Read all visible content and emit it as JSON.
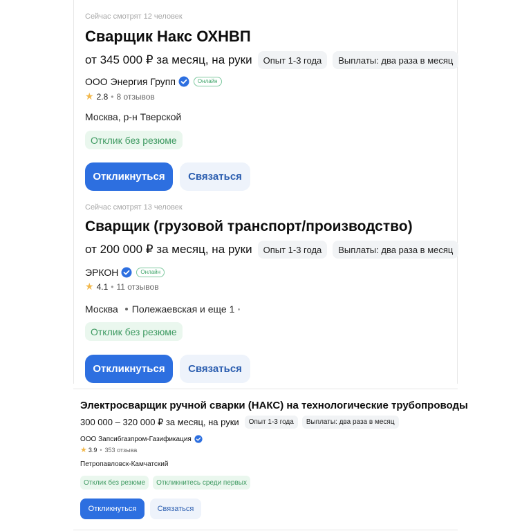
{
  "vacancies": [
    {
      "views": "Сейчас смотрят 12 человек",
      "title": "Сварщик Накс ОХНВП",
      "salary": "от 345 000 ₽ за месяц, на руки",
      "experience": "Опыт 1-3 года",
      "payments": "Выплаты: два раза в месяц",
      "company": "ООО Энергия Групп",
      "online": "Онлайн",
      "rating": "2.8",
      "reviews": "8 отзывов",
      "location": "Москва, р-н Тверской",
      "tag1": "Отклик без резюме",
      "apply": "Откликнуться",
      "contact": "Связаться"
    },
    {
      "views": "Сейчас смотрят 13 человек",
      "title": "Сварщик (грузовой транспорт/производство)",
      "salary": "от 200 000 ₽ за месяц, на руки",
      "experience": "Опыт 1-3 года",
      "payments": "Выплаты: два раза в месяц",
      "company": "ЭРКОН",
      "online": "Онлайн",
      "rating": "4.1",
      "reviews": "11 отзывов",
      "location": "Москва",
      "metro": "Полежаевская и еще 1",
      "tag1": "Отклик без резюме",
      "apply": "Откликнуться",
      "contact": "Связаться"
    },
    {
      "title": "Электросварщик ручной сварки (НАКС) на технологические трубопроводы",
      "salary": "300 000 – 320 000 ₽ за месяц, на руки",
      "experience": "Опыт 1-3 года",
      "payments": "Выплаты: два раза в месяц",
      "company": "ООО Запсибгазпром-Газификация",
      "rating": "3.9",
      "reviews": "353 отзыва",
      "location": "Петропавловск-Камчатский",
      "tag1": "Отклик без резюме",
      "tag2": "Откликнитесь среди первых",
      "apply": "Откликнуться",
      "contact": "Связаться"
    }
  ],
  "icons": {
    "verified": "verified-check-icon",
    "star": "star-icon"
  },
  "colors": {
    "primary": "#2d6fe0",
    "secondary_bg": "#eef3fb",
    "green_tag_bg": "#eaf7ee",
    "green_tag_text": "#3f9a62",
    "chip_bg": "#f1f3f5",
    "star": "#f2b84c",
    "verified": "#2d6fe0"
  }
}
